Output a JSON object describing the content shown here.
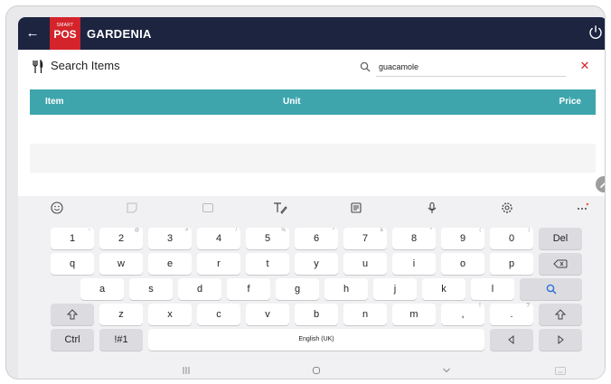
{
  "app": {
    "logo_small": "SMART",
    "logo_big": "POS",
    "title": "GARDENIA",
    "colors": {
      "topbar": "#1c2440",
      "brand": "#d4232a",
      "header": "#3ea5ad"
    }
  },
  "search": {
    "title": "Search Items",
    "value": "guacamole",
    "clear_icon": "close-icon"
  },
  "table": {
    "columns": [
      "Item",
      "Unit",
      "Price"
    ]
  },
  "keyboard": {
    "toolbar": [
      "emoji-icon",
      "sticker-icon",
      "gif-icon",
      "handwriting-icon",
      "clipboard-icon",
      "mic-icon",
      "settings-icon",
      "more-icon"
    ],
    "row1": [
      {
        "k": "1",
        "h": "~"
      },
      {
        "k": "2",
        "h": "@"
      },
      {
        "k": "3",
        "h": "#"
      },
      {
        "k": "4",
        "h": "/"
      },
      {
        "k": "5",
        "h": "%"
      },
      {
        "k": "6",
        "h": "^"
      },
      {
        "k": "7",
        "h": "&"
      },
      {
        "k": "8",
        "h": "*"
      },
      {
        "k": "9",
        "h": "("
      },
      {
        "k": "0",
        "h": ")"
      }
    ],
    "del": "Del",
    "row2": [
      "q",
      "w",
      "e",
      "r",
      "t",
      "y",
      "u",
      "i",
      "o",
      "p"
    ],
    "row3": [
      "a",
      "s",
      "d",
      "f",
      "g",
      "h",
      "j",
      "k",
      "l"
    ],
    "row4": [
      "z",
      "x",
      "c",
      "v",
      "b",
      "n",
      "m"
    ],
    "comma": ",",
    "comma_hint": "!",
    "period": ".",
    "period_hint": "?",
    "ctrl": "Ctrl",
    "symbols": "!#1",
    "space": "English (UK)"
  }
}
